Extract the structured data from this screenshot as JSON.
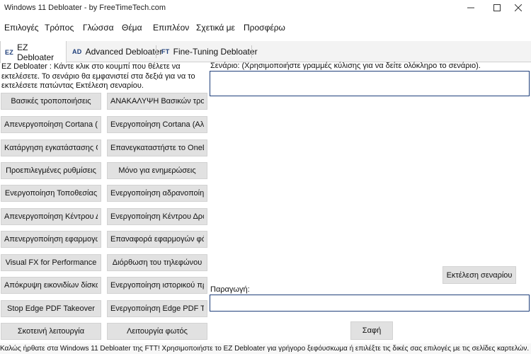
{
  "window": {
    "title": "Windows 11 Debloater - by FreeTimeTech.com",
    "minimize_icon": "minimize-icon",
    "maximize_icon": "maximize-icon",
    "close_icon": "close-icon"
  },
  "menu": {
    "items": [
      "Επιλογές",
      "Τρόπος",
      "Γλώσσα",
      "Θέμα",
      "Επιπλέον",
      "Σχετικά με",
      "Προσφέρω"
    ]
  },
  "tabs": [
    {
      "abbr": "EZ",
      "label": "EZ Debloater"
    },
    {
      "abbr": "AD",
      "label": "Advanced Debloater"
    },
    {
      "abbr": "FT",
      "label": "Fine-Tuning Debloater"
    }
  ],
  "description": "EZ Debloater : Κάντε κλικ στο κουμπί που θέλετε να εκτελέσετε. Το σενάριο θα εμφανιστεί στα δεξιά για να το εκτελέσετε πατώντας Εκτέλεση σεναρίου.",
  "buttons_left": [
    "Βασικές τροποποιήσεις",
    "Απενεργοποίηση Cortana (Αλεξα)",
    "Κατάργηση εγκατάστασης OneDrive",
    "Προεπιλεγμένες ρυθμίσεις",
    "Ενεργοποίηση Τοποθεσίας",
    "Απενεργοποίηση Κέντρου Δράσης",
    "Απενεργοποίηση εφαρμογών φόντου",
    "Visual FX for Performance",
    "Απόκρυψη εικονιδίων δίσκου",
    "Stop Edge PDF Takeover",
    "Σκοτεινή λειτουργία"
  ],
  "buttons_right": [
    "ΑΝΑΚΑΛΥΨΗ Βασικών τροποποιήσεων",
    "Ενεργοποίηση Cortana (Αλεξα)",
    "Επανεγκαταστήστε το OneDrive",
    "Μόνο για ενημερώσεις",
    "Ενεργοποίηση αδρανοποίησης",
    "Ενεργοποίηση Κέντρου Δράσης",
    "Επαναφορά εφαρμογών φόντου",
    "Διόρθωση του τηλεφώνου",
    "Ενεργοποίηση ιστορικού πρόχειρου",
    "Ενεργοποίηση Edge PDF Takeover",
    "Λειτουργία φωτός"
  ],
  "script_label": "Σενάριο: (Χρησιμοποιήστε γραμμές κύλισης για να δείτε ολόκληρο το σενάριο).",
  "script_value": "",
  "run_button": "Εκτέλεση σεναρίου",
  "output_label": "Παραγωγή:",
  "output_value": "",
  "clear_button": "Σαφή",
  "status": "Καλώς ήρθατε στα Windows 11 Debloater της FTT! Χρησιμοποιήστε το EZ Debloater για γρήγορο ξεφόυσκωμα ή επιλέξτε τις δικές σας επιλογές με τις σελίδες καρτελών."
}
